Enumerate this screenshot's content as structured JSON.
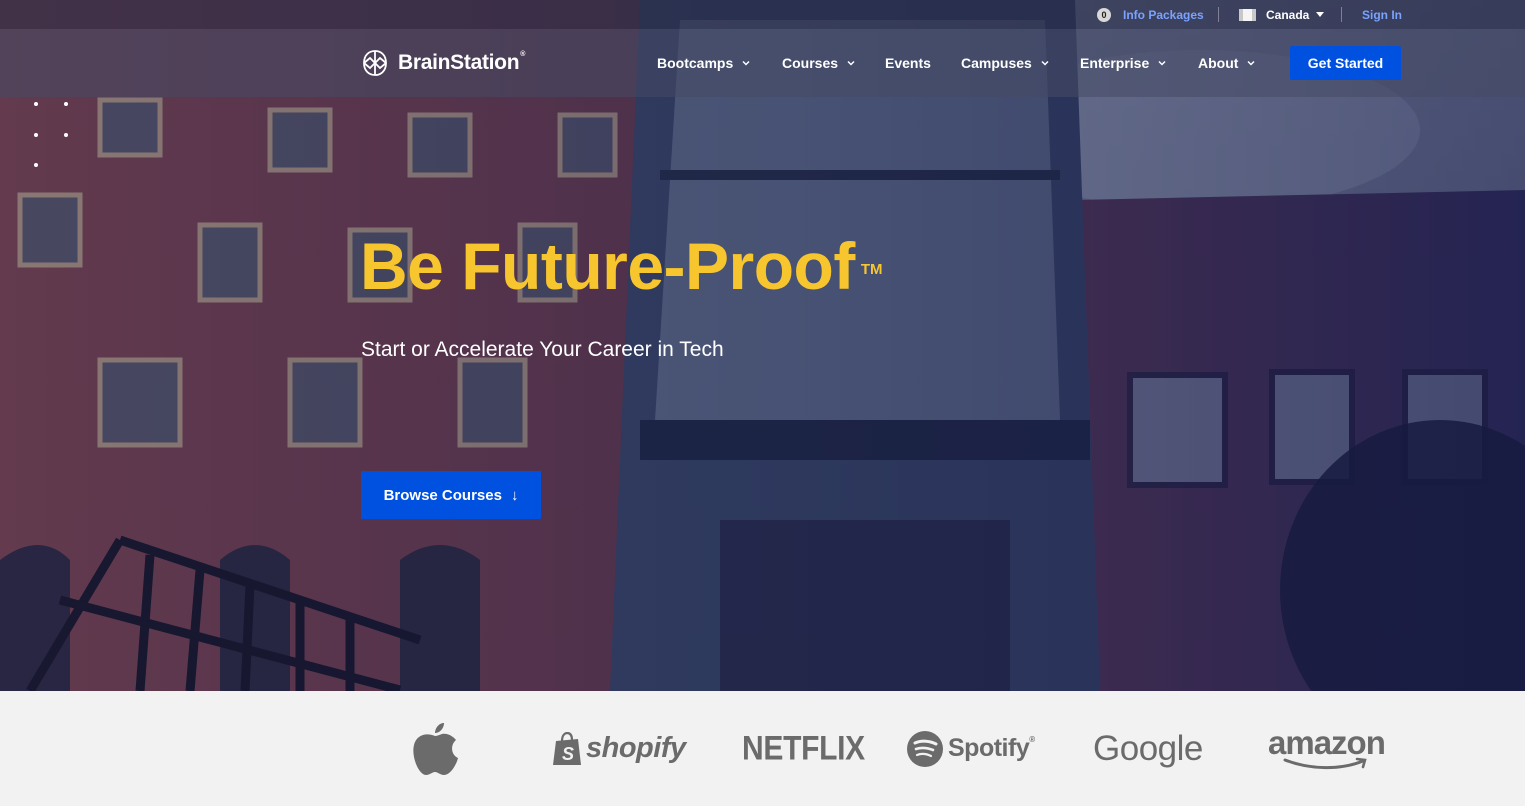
{
  "utility": {
    "cart_count": "0",
    "info_packages": "Info Packages",
    "country": "Canada",
    "sign_in": "Sign In"
  },
  "brand": {
    "name": "BrainStation",
    "registered_mark": "®"
  },
  "nav": {
    "items": [
      {
        "label": "Bootcamps",
        "has_dropdown": true
      },
      {
        "label": "Courses",
        "has_dropdown": true
      },
      {
        "label": "Events",
        "has_dropdown": false
      },
      {
        "label": "Campuses",
        "has_dropdown": true
      },
      {
        "label": "Enterprise",
        "has_dropdown": true
      },
      {
        "label": "About",
        "has_dropdown": true
      }
    ],
    "cta": "Get Started"
  },
  "hero": {
    "headline": "Be Future-Proof",
    "trademark": "TM",
    "subheadline": "Start or Accelerate Your Career in Tech",
    "button": "Browse Courses",
    "button_icon": "arrow-down-icon"
  },
  "partners": [
    {
      "name": "Apple",
      "icon": "apple-logo-icon"
    },
    {
      "name": "shopify",
      "icon": "shopify-bag-icon"
    },
    {
      "name": "NETFLIX"
    },
    {
      "name": "Spotify",
      "icon": "spotify-icon",
      "mark": "®"
    },
    {
      "name": "Google"
    },
    {
      "name": "amazon",
      "icon": "amazon-smile-icon"
    }
  ],
  "colors": {
    "accent_blue": "#0051e0",
    "headline_yellow": "#f7c62f",
    "link_blue": "#7aa2ff",
    "logo_gray": "#6b6b6b",
    "strip_bg": "#f2f2f2"
  }
}
